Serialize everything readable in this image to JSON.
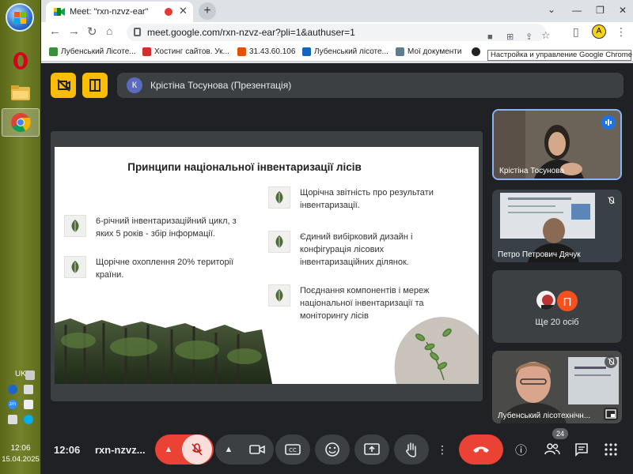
{
  "taskbar": {
    "lang": "UK",
    "time": "12:06",
    "date": "15.04.2025",
    "tray_zm": "zm"
  },
  "browser": {
    "tab_title": "Meet: \"rxn-nzvz-ear\"",
    "url": "meet.google.com/rxn-nzvz-ear?pli=1&authuser=1",
    "profile_initial": "A",
    "tooltip": "Настройка и управление Google Chrome",
    "bookmarks": [
      {
        "label": "Лубенський Лісоте...",
        "color": "#3a8f3a"
      },
      {
        "label": "Хостинг сайтов. Ук...",
        "color": "#d32f2f"
      },
      {
        "label": "31.43.60.106",
        "color": "#e65100"
      },
      {
        "label": "Лубенський лісоте...",
        "color": "#1565c0"
      },
      {
        "label": "Мої документи",
        "color": "#607d8b"
      }
    ]
  },
  "meet": {
    "presenter_initial": "К",
    "presenter_label": "Крістіна Тосунова (Презентація)",
    "slide": {
      "title": "Принципи національної інвентаризації лісів",
      "bullets_left": [
        "6-річний інвентаризаційний цикл, з яких 5 років - збір інформації.",
        "Щорічне охоплення 20% території країни."
      ],
      "bullets_right": [
        "Щорічна звітність про результати інвентаризації.",
        "Єдиний вибірковий дизайн і конфігурація лісових інвентаризаційних ділянок.",
        "Поєднання компонентів і мереж національної інвентаризації та моніторингу лісів"
      ]
    },
    "tiles": [
      {
        "name": "Крістіна Тосунова"
      },
      {
        "name": "Петро Петрович Дячук"
      },
      {
        "name": "Ще 20 осіб",
        "initial": "П"
      },
      {
        "name": "Лубенський лісотехнічн..."
      }
    ],
    "bottom": {
      "time": "12:06",
      "meeting_code": "rxn-nzvz...",
      "participants_count": "24"
    },
    "colors": {
      "accent_yellow": "#fbbc04",
      "end_call": "#ea4335",
      "mic_off": "#ea4335"
    }
  }
}
